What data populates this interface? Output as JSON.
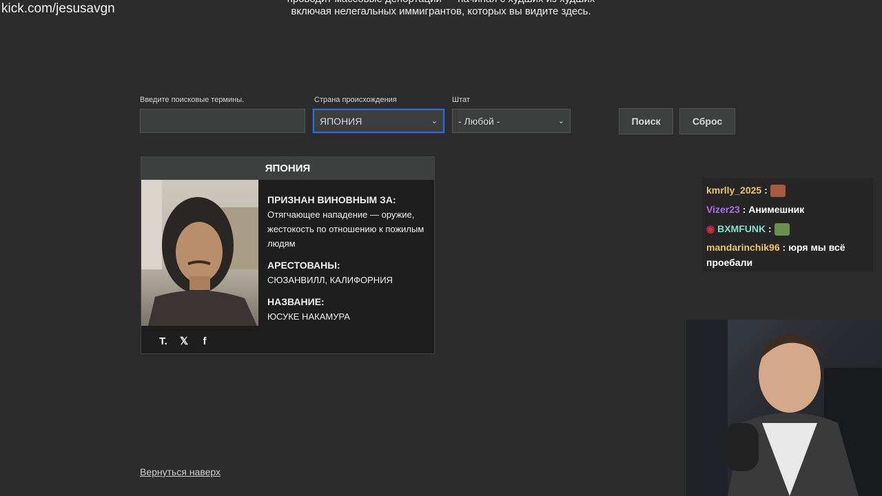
{
  "watermark": "kick.com/jesusavgn",
  "intro": {
    "line1": "проводит массовые депортации — начиная с худших из худших",
    "line2": "включая нелегальных иммигрантов, которых вы видите здесь."
  },
  "search": {
    "terms_label": "Введите поисковые термины.",
    "terms_value": "",
    "country_label": "Страна происхождения",
    "country_value": "ЯПОНИЯ",
    "state_label": "Штат",
    "state_value": "- Любой -",
    "search_button": "Поиск",
    "reset_button": "Сброс"
  },
  "card": {
    "header": "ЯПОНИЯ",
    "convicted_label": "ПРИЗНАН ВИНОВНЫМ ЗА:",
    "convicted_value": "Отягчающее нападение — оружие, жестокость по отношению к пожилым людям",
    "arrested_label": "АРЕСТОВАНЫ:",
    "arrested_value": "СЮЗАНВИЛЛ, КАЛИФОРНИЯ",
    "name_label": "НАЗВАНИЕ:",
    "name_value": "ЮСУКЕ НАКАМУРА",
    "socials": [
      {
        "icon": "truth-social-icon",
        "glyph": "T."
      },
      {
        "icon": "x-icon",
        "glyph": "𝕏"
      },
      {
        "icon": "facebook-icon",
        "glyph": "f"
      }
    ]
  },
  "back_to_top": "Вернуться наверх",
  "chat": {
    "messages": [
      {
        "user": "kmrlly_2025",
        "color": "#f0c26a",
        "text": ""
      },
      {
        "user": "Vizer23",
        "color": "#b46cf0",
        "text": "Анимешник"
      },
      {
        "user": "BXMFUNK",
        "color": "#7fe0d0",
        "text": ""
      },
      {
        "user": "mandarinchik96",
        "color": "#f0c26a",
        "text": "юря мы всё проебали"
      }
    ]
  },
  "colors": {
    "background": "#2b2c2b",
    "focus": "#2f6fd0"
  }
}
